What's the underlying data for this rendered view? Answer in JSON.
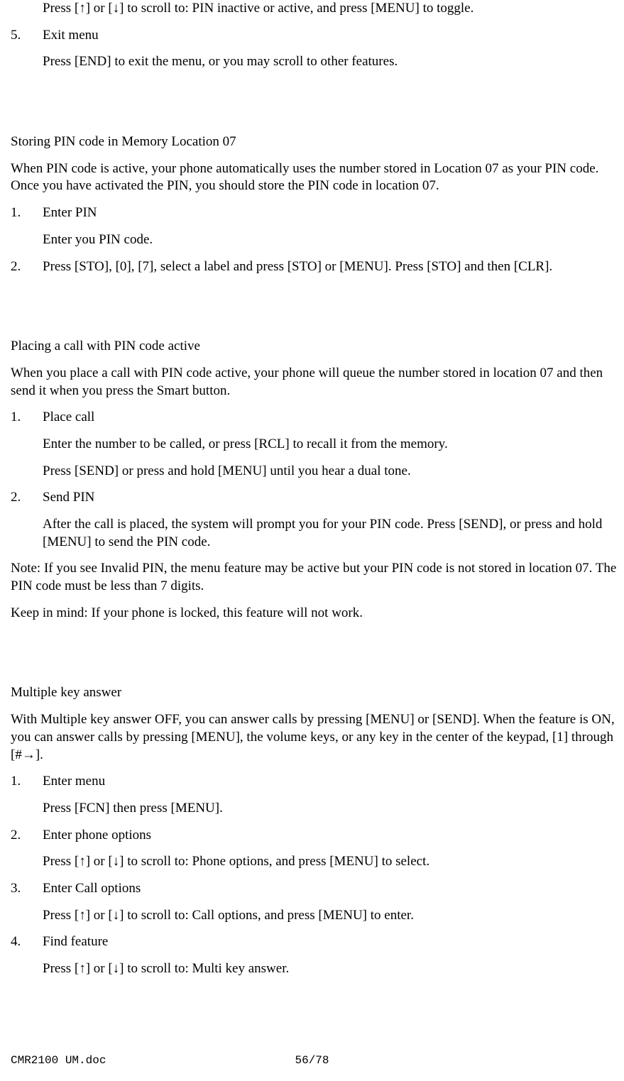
{
  "top": {
    "instruction": "Press [↑] or [↓] to scroll to: PIN inactive or active, and press [MENU] to toggle.",
    "item5_num": "5.",
    "item5_label": "Exit menu",
    "item5_detail": "Press [END] to exit the menu, or you may scroll to other features."
  },
  "storing": {
    "title": "Storing PIN code in Memory Location 07",
    "intro": "When PIN code is active, your phone automatically uses the number stored in Location 07 as your PIN code. Once you have activated the PIN, you should store the PIN code in location 07.",
    "item1_num": "1.",
    "item1_label": "Enter PIN",
    "item1_detail": "Enter you PIN code.",
    "item2_num": "2.",
    "item2_label": "Press [STO], [0], [7], select a label and press [STO] or [MENU]. Press [STO] and then [CLR]."
  },
  "placing": {
    "title": "Placing a call with PIN code active",
    "intro": "When you place a call with PIN code active, your phone will queue the number stored in location 07 and then send it when you press the Smart button.",
    "item1_num": "1.",
    "item1_label": "Place call",
    "item1_detail1": "Enter the number to be called, or press [RCL] to recall it from the memory.",
    "item1_detail2": "Press [SEND] or press and hold [MENU] until you hear a dual tone.",
    "item2_num": "2.",
    "item2_label": "Send PIN",
    "item2_detail": "After the call is placed, the system will prompt you for your PIN code. Press [SEND], or press and hold [MENU] to send the PIN code.",
    "note": "Note:  If you see Invalid PIN, the menu feature may be active but your PIN code is not stored in location 07. The PIN code must be less than 7 digits.",
    "keep": "Keep in mind:  If your phone is locked, this feature will not work."
  },
  "multi": {
    "title": "Multiple key answer",
    "intro": "With Multiple key answer OFF, you can answer calls by pressing [MENU] or [SEND]. When the feature is ON, you can answer calls by pressing [MENU], the volume keys, or any key in the center of the keypad, [1] through [#→].",
    "item1_num": "1.",
    "item1_label": "Enter menu",
    "item1_detail": "Press [FCN] then press [MENU].",
    "item2_num": "2.",
    "item2_label": "Enter phone options",
    "item2_detail": "Press [↑] or [↓] to scroll to: Phone options, and press [MENU] to select.",
    "item3_num": "3.",
    "item3_label": "Enter Call options",
    "item3_detail": "Press [↑] or [↓] to scroll to: Call options, and press [MENU] to enter.",
    "item4_num": "4.",
    "item4_label": "Find feature",
    "item4_detail": "Press [↑] or [↓] to scroll to: Multi key answer."
  },
  "footer": {
    "doc": "CMR2100 UM.doc",
    "page": "56/78"
  }
}
